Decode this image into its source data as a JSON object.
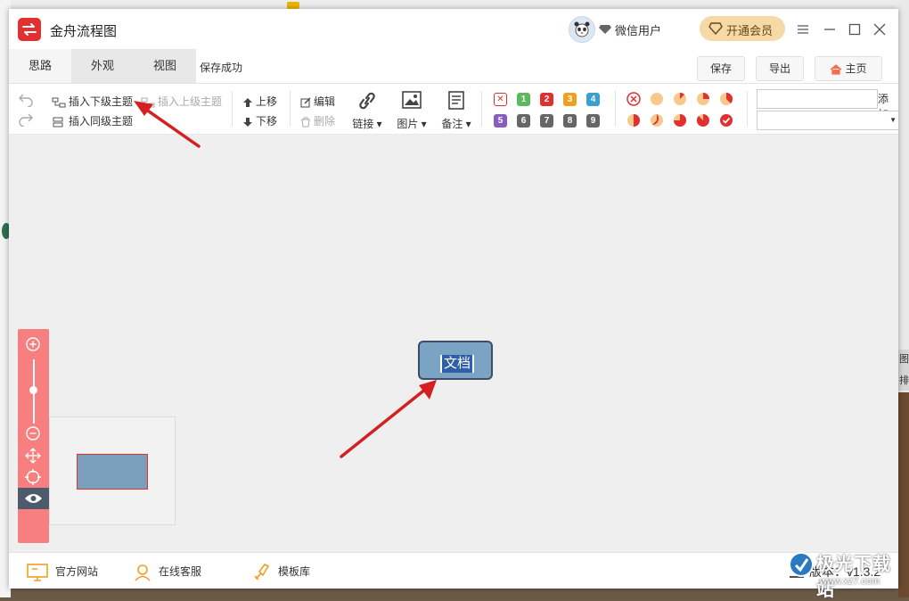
{
  "app": {
    "title": "金舟流程图"
  },
  "user": {
    "name": "微信用户",
    "vip_label": "开通会员"
  },
  "tabs": [
    {
      "label": "思路"
    },
    {
      "label": "外观"
    },
    {
      "label": "视图"
    }
  ],
  "menubar": {
    "save_status": "保存成功",
    "save": "保存",
    "export": "导出",
    "home": "主页"
  },
  "toolbar": {
    "insert_child": "插入下级主题",
    "insert_parent": "插入上级主题",
    "insert_sibling": "插入同级主题",
    "move_up": "上移",
    "move_down": "下移",
    "edit": "编辑",
    "delete": "删除",
    "link": "链接",
    "image": "图片",
    "note": "备注",
    "priority_numbers": [
      "1",
      "2",
      "3",
      "4",
      "5",
      "6",
      "7",
      "8",
      "9"
    ],
    "add": "添加"
  },
  "canvas": {
    "node_text": "文档"
  },
  "statusbar": {
    "website": "官方网站",
    "support": "在线客服",
    "templates": "模板库",
    "version": "版本：v1.3.2"
  },
  "watermark": {
    "text": "极光下载站",
    "url": "www.xz7.com"
  },
  "background": {
    "right_tab_1": "图",
    "right_tab_2": "排"
  },
  "colors": {
    "accent_red": "#e03030",
    "zoom_bar": "#f77f7f",
    "node_fill": "#7aa3c4",
    "node_border": "#3b4e66",
    "vip": "#f6d9a6",
    "annotation_arrow": "#d42020"
  }
}
